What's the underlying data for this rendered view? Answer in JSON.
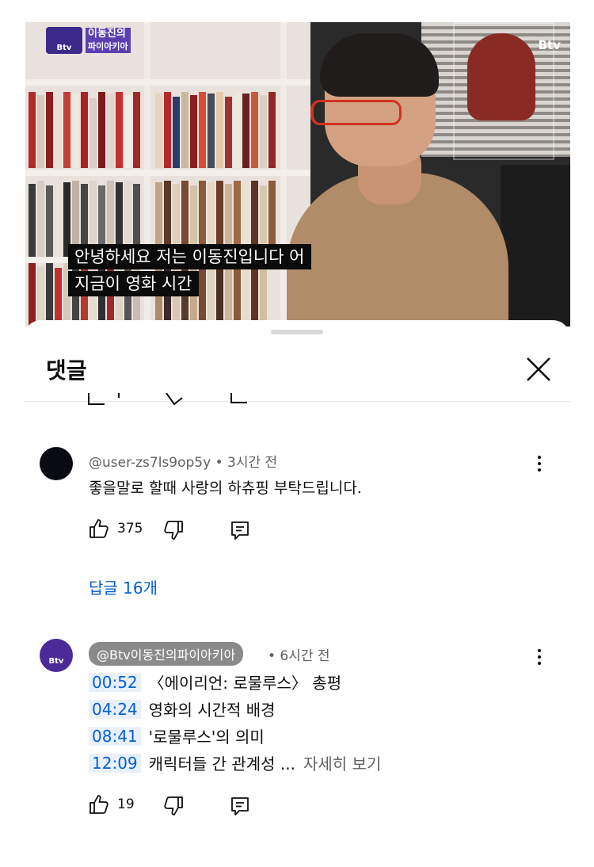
{
  "video": {
    "channel_logo_badge": "Btv",
    "channel_logo_line1": "이동진의",
    "channel_logo_line2": "파이아키아",
    "watermark": "Btv",
    "caption_line1": "안녕하세요 저는 이동진입니다 어",
    "caption_line2": "지금이 영화 시간"
  },
  "sheet": {
    "title": "댓글"
  },
  "comments": [
    {
      "author": "@user-zs7ls9op5y",
      "time": "• 3시간 전",
      "text": "좋을말로 할때 사랑의 하츄핑 부탁드립니다.",
      "likes": "375",
      "replies_label": "답글 16개"
    },
    {
      "author": "@Btv이동진의파이아키아",
      "avatar_label": "Btv",
      "time": "• 6시간 전",
      "chapters": [
        {
          "ts": "00:52",
          "title": "〈에이리언: 로물루스〉 총평"
        },
        {
          "ts": "04:24",
          "title": "영화의 시간적 배경"
        },
        {
          "ts": "08:41",
          "title": "'로물루스'의 의미"
        },
        {
          "ts": "12:09",
          "title": "캐릭터들 간 관계성 ...",
          "more": "자세히 보기"
        }
      ],
      "likes": "19"
    }
  ],
  "icons": {
    "like": "thumbs-up-icon",
    "dislike": "thumbs-down-icon",
    "reply": "reply-icon",
    "more": "kebab-menu-icon",
    "close": "close-icon"
  },
  "colors": {
    "link_blue": "#065fd4",
    "timestamp_bg": "#e8f0fb",
    "meta_gray": "#606060"
  }
}
